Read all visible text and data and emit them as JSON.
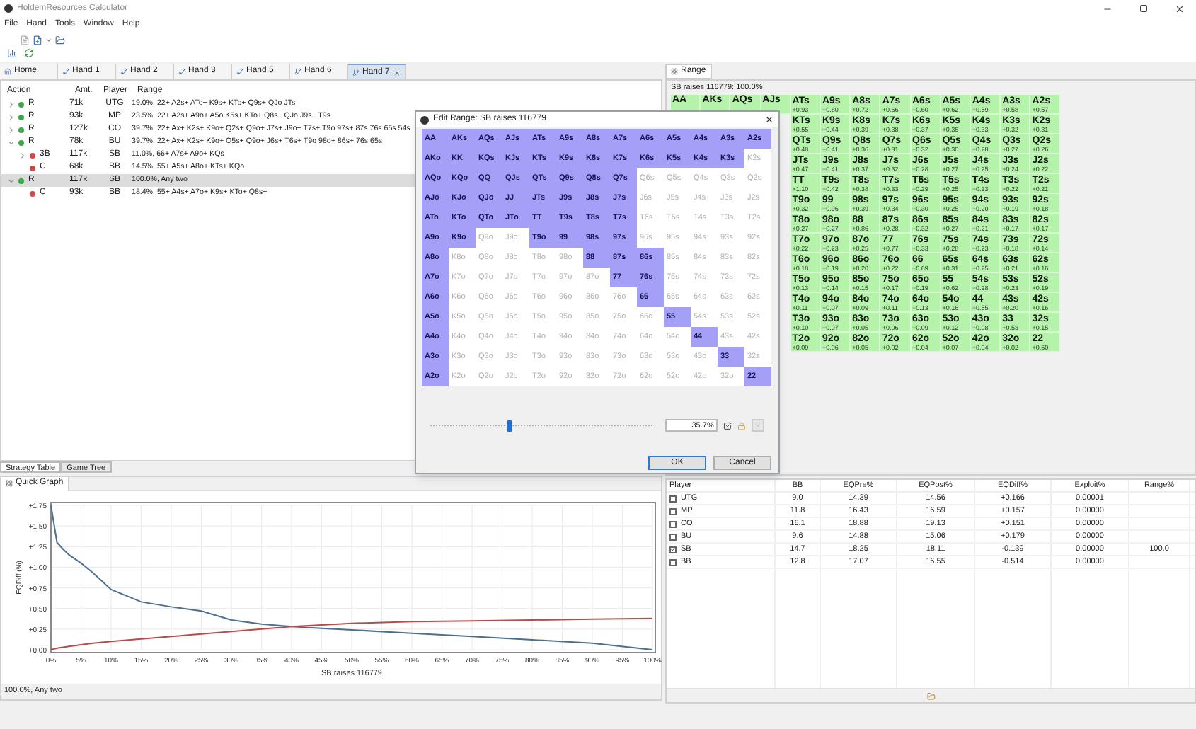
{
  "window": {
    "title": "HoldemResources Calculator"
  },
  "menu": [
    "File",
    "Hand",
    "Tools",
    "Window",
    "Help"
  ],
  "hand_tabs": [
    {
      "label": "Home",
      "selected": false
    },
    {
      "label": "Hand 1",
      "selected": false
    },
    {
      "label": "Hand 2",
      "selected": false
    },
    {
      "label": "Hand 3",
      "selected": false
    },
    {
      "label": "Hand 5",
      "selected": false
    },
    {
      "label": "Hand 6",
      "selected": false
    },
    {
      "label": "Hand 7",
      "selected": true
    }
  ],
  "action_tree": {
    "columns": [
      "Action",
      "Amt.",
      "Player",
      "Range"
    ],
    "items": [
      {
        "kind": "collapsed",
        "action": "R",
        "amt": "71k",
        "player": "UTG",
        "range": "19.0%, 22+ A2s+ ATo+ K9s+ KTo+ Q9s+ QJo JTs",
        "color": "#3ea84a",
        "selected": false
      },
      {
        "kind": "collapsed",
        "action": "R",
        "amt": "93k",
        "player": "MP",
        "range": "23.5%, 22+ A2s+ A9o+ A5o K5s+ KTo+ Q8s+ QJo J9s+ T9s",
        "color": "#3ea84a",
        "selected": false
      },
      {
        "kind": "collapsed",
        "action": "R",
        "amt": "127k",
        "player": "CO",
        "range": "39.7%, 22+ Ax+ K2s+ K9o+ Q2s+ Q9o+ J7s+ J9o+ T7s+ T9o 97s+ 87s 76s 65s 54s",
        "color": "#3ea84a",
        "selected": false
      },
      {
        "kind": "expanded",
        "action": "R",
        "amt": "78k",
        "player": "BU",
        "range": "39.7%, 22+ Ax+ K2s+ K9o+ Q5s+ Q9o+ J6s+ T6s+ T9o 98o+ 86s+ 76s 65s",
        "color": "#3ea84a",
        "selected": false,
        "children": [
          {
            "kind": "collapsed",
            "action": "3B",
            "amt": "117k",
            "player": "SB",
            "range": "11.0%, 66+ A7s+ A9o+ KQs",
            "color": "#d04848",
            "selected": false
          },
          {
            "kind": "leaf",
            "action": "C",
            "amt": "68k",
            "player": "BB",
            "range": "14.5%, 55+ A5s+ A8o+ KTs+ KQo",
            "color": "#d04848",
            "selected": false
          }
        ]
      },
      {
        "kind": "expanded",
        "action": "R",
        "amt": "117k",
        "player": "SB",
        "range": "100.0%, Any two",
        "color": "#3ea84a",
        "selected": true,
        "children": [
          {
            "kind": "leaf",
            "action": "C",
            "amt": "93k",
            "player": "BB",
            "range": "18.4%, 55+ A4s+ A7o+ K9s+ KTo+ Q8s+",
            "color": "#d04848",
            "selected": false
          }
        ]
      }
    ]
  },
  "bottom_tabs": [
    {
      "label": "Strategy Table",
      "selected": true
    },
    {
      "label": "Game Tree",
      "selected": false
    }
  ],
  "quick_graph": {
    "title": "Quick Graph",
    "status": "100.0%, Any two",
    "chart_data": {
      "type": "line",
      "xlabel": "SB raises 116779",
      "ylabel": "EQDiff (%)",
      "x": [
        0,
        1,
        2,
        3,
        5,
        7,
        10,
        15,
        20,
        25,
        30,
        35,
        40,
        45,
        50,
        60,
        70,
        80,
        90,
        100
      ],
      "series": [
        {
          "color": "#4a6f8f",
          "values": [
            1.75,
            1.3,
            1.22,
            1.15,
            1.05,
            0.93,
            0.73,
            0.58,
            0.52,
            0.47,
            0.36,
            0.31,
            0.28,
            0.26,
            0.24,
            0.2,
            0.16,
            0.12,
            0.08,
            0.0
          ]
        },
        {
          "color": "#b84a4a",
          "values": [
            0.0,
            0.02,
            0.03,
            0.04,
            0.06,
            0.08,
            0.1,
            0.13,
            0.16,
            0.19,
            0.22,
            0.25,
            0.28,
            0.3,
            0.32,
            0.34,
            0.35,
            0.36,
            0.37,
            0.38
          ]
        }
      ],
      "xlim": [
        0,
        100
      ],
      "ylim": [
        0,
        1.75
      ],
      "grid": true,
      "xticks": [
        {
          "value": 0,
          "label": "0%"
        },
        {
          "value": 5,
          "label": "5%"
        },
        {
          "value": 10,
          "label": "10%"
        },
        {
          "value": 15,
          "label": "15%"
        },
        {
          "value": 20,
          "label": "20%"
        },
        {
          "value": 25,
          "label": "25%"
        },
        {
          "value": 30,
          "label": "30%"
        },
        {
          "value": 35,
          "label": "35%"
        },
        {
          "value": 40,
          "label": "40%"
        },
        {
          "value": 45,
          "label": "45%"
        },
        {
          "value": 50,
          "label": "50%"
        },
        {
          "value": 55,
          "label": "55%"
        },
        {
          "value": 60,
          "label": "60%"
        },
        {
          "value": 65,
          "label": "65%"
        },
        {
          "value": 70,
          "label": "70%"
        },
        {
          "value": 75,
          "label": "75%"
        },
        {
          "value": 80,
          "label": "80%"
        },
        {
          "value": 85,
          "label": "85%"
        },
        {
          "value": 90,
          "label": "90%"
        },
        {
          "value": 95,
          "label": "95%"
        },
        {
          "value": 100,
          "label": "100%"
        }
      ],
      "yticks": [
        {
          "value": 0,
          "label": "+0.00"
        },
        {
          "value": 0.25,
          "label": "+0.25"
        },
        {
          "value": 0.5,
          "label": "+0.50"
        },
        {
          "value": 0.75,
          "label": "+0.75"
        },
        {
          "value": 1,
          "label": "+1.00"
        },
        {
          "value": 1.25,
          "label": "+1.25"
        },
        {
          "value": 1.5,
          "label": "+1.50"
        },
        {
          "value": 1.75,
          "label": "+1.75"
        }
      ]
    }
  },
  "range_panel": {
    "tab": "Range",
    "title": "SB raises 116779: 100.0%",
    "rows": [
      {
        "cells": [
          {
            "hand": "AA"
          },
          {
            "hand": "AKs"
          },
          {
            "hand": "AQs"
          },
          {
            "hand": "AJs"
          },
          {
            "hand": "ATs",
            "ev": "+0.93"
          },
          {
            "hand": "A9s",
            "ev": "+0.80"
          },
          {
            "hand": "A8s",
            "ev": "+0.72"
          },
          {
            "hand": "A7s",
            "ev": "+0.66"
          },
          {
            "hand": "A6s",
            "ev": "+0.60"
          },
          {
            "hand": "A5s",
            "ev": "+0.62"
          },
          {
            "hand": "A4s",
            "ev": "+0.59"
          },
          {
            "hand": "A3s",
            "ev": "+0.58"
          },
          {
            "hand": "A2s",
            "ev": "+0.57"
          }
        ]
      },
      {
        "cells": [
          {},
          {},
          {},
          {},
          {
            "hand": "KTs",
            "ev": "+0.55"
          },
          {
            "hand": "K9s",
            "ev": "+0.44"
          },
          {
            "hand": "K8s",
            "ev": "+0.39"
          },
          {
            "hand": "K7s",
            "ev": "+0.38"
          },
          {
            "hand": "K6s",
            "ev": "+0.37"
          },
          {
            "hand": "K5s",
            "ev": "+0.35"
          },
          {
            "hand": "K4s",
            "ev": "+0.33"
          },
          {
            "hand": "K3s",
            "ev": "+0.32"
          },
          {
            "hand": "K2s",
            "ev": "+0.31"
          }
        ]
      },
      {
        "cells": [
          {},
          {},
          {},
          {},
          {
            "hand": "QTs",
            "ev": "+0.48"
          },
          {
            "hand": "Q9s",
            "ev": "+0.41"
          },
          {
            "hand": "Q8s",
            "ev": "+0.36"
          },
          {
            "hand": "Q7s",
            "ev": "+0.31"
          },
          {
            "hand": "Q6s",
            "ev": "+0.32"
          },
          {
            "hand": "Q5s",
            "ev": "+0.30"
          },
          {
            "hand": "Q4s",
            "ev": "+0.28"
          },
          {
            "hand": "Q3s",
            "ev": "+0.27"
          },
          {
            "hand": "Q2s",
            "ev": "+0.26"
          }
        ]
      },
      {
        "cells": [
          {},
          {},
          {},
          {},
          {
            "hand": "JTs",
            "ev": "+0.47"
          },
          {
            "hand": "J9s",
            "ev": "+0.41"
          },
          {
            "hand": "J8s",
            "ev": "+0.37"
          },
          {
            "hand": "J7s",
            "ev": "+0.32"
          },
          {
            "hand": "J6s",
            "ev": "+0.28"
          },
          {
            "hand": "J5s",
            "ev": "+0.27"
          },
          {
            "hand": "J4s",
            "ev": "+0.25"
          },
          {
            "hand": "J3s",
            "ev": "+0.24"
          },
          {
            "hand": "J2s",
            "ev": "+0.22"
          }
        ]
      },
      {
        "cells": [
          {},
          {},
          {},
          {},
          {
            "hand": "TT",
            "ev": "+1.10"
          },
          {
            "hand": "T9s",
            "ev": "+0.42"
          },
          {
            "hand": "T8s",
            "ev": "+0.38"
          },
          {
            "hand": "T7s",
            "ev": "+0.33"
          },
          {
            "hand": "T6s",
            "ev": "+0.29"
          },
          {
            "hand": "T5s",
            "ev": "+0.25"
          },
          {
            "hand": "T4s",
            "ev": "+0.23"
          },
          {
            "hand": "T3s",
            "ev": "+0.22"
          },
          {
            "hand": "T2s",
            "ev": "+0.21"
          }
        ]
      },
      {
        "cells": [
          {},
          {},
          {},
          {},
          {
            "hand": "T9o",
            "ev": "+0.32"
          },
          {
            "hand": "99",
            "ev": "+0.96"
          },
          {
            "hand": "98s",
            "ev": "+0.39"
          },
          {
            "hand": "97s",
            "ev": "+0.34"
          },
          {
            "hand": "96s",
            "ev": "+0.30"
          },
          {
            "hand": "95s",
            "ev": "+0.25"
          },
          {
            "hand": "94s",
            "ev": "+0.20"
          },
          {
            "hand": "93s",
            "ev": "+0.19"
          },
          {
            "hand": "92s",
            "ev": "+0.18"
          }
        ]
      },
      {
        "cells": [
          {},
          {},
          {},
          {},
          {
            "hand": "T8o",
            "ev": "+0.27"
          },
          {
            "hand": "98o",
            "ev": "+0.27"
          },
          {
            "hand": "88",
            "ev": "+0.86"
          },
          {
            "hand": "87s",
            "ev": "+0.28"
          },
          {
            "hand": "86s",
            "ev": "+0.32"
          },
          {
            "hand": "85s",
            "ev": "+0.27"
          },
          {
            "hand": "84s",
            "ev": "+0.21"
          },
          {
            "hand": "83s",
            "ev": "+0.17"
          },
          {
            "hand": "82s",
            "ev": "+0.17"
          }
        ]
      },
      {
        "cells": [
          {},
          {},
          {},
          {},
          {
            "hand": "T7o",
            "ev": "+0.22"
          },
          {
            "hand": "97o",
            "ev": "+0.23"
          },
          {
            "hand": "87o",
            "ev": "+0.25"
          },
          {
            "hand": "77",
            "ev": "+0.77"
          },
          {
            "hand": "76s",
            "ev": "+0.33"
          },
          {
            "hand": "75s",
            "ev": "+0.28"
          },
          {
            "hand": "74s",
            "ev": "+0.23"
          },
          {
            "hand": "73s",
            "ev": "+0.18"
          },
          {
            "hand": "72s",
            "ev": "+0.14"
          }
        ]
      },
      {
        "cells": [
          {},
          {},
          {},
          {},
          {
            "hand": "T6o",
            "ev": "+0.18"
          },
          {
            "hand": "96o",
            "ev": "+0.19"
          },
          {
            "hand": "86o",
            "ev": "+0.20"
          },
          {
            "hand": "76o",
            "ev": "+0.22"
          },
          {
            "hand": "66",
            "ev": "+0.69"
          },
          {
            "hand": "65s",
            "ev": "+0.31"
          },
          {
            "hand": "64s",
            "ev": "+0.25"
          },
          {
            "hand": "63s",
            "ev": "+0.21"
          },
          {
            "hand": "62s",
            "ev": "+0.16"
          }
        ]
      },
      {
        "cells": [
          {},
          {},
          {},
          {},
          {
            "hand": "T5o",
            "ev": "+0.13"
          },
          {
            "hand": "95o",
            "ev": "+0.14"
          },
          {
            "hand": "85o",
            "ev": "+0.15"
          },
          {
            "hand": "75o",
            "ev": "+0.17"
          },
          {
            "hand": "65o",
            "ev": "+0.19"
          },
          {
            "hand": "55",
            "ev": "+0.62"
          },
          {
            "hand": "54s",
            "ev": "+0.28"
          },
          {
            "hand": "53s",
            "ev": "+0.23"
          },
          {
            "hand": "52s",
            "ev": "+0.19"
          }
        ]
      },
      {
        "cells": [
          {},
          {},
          {},
          {},
          {
            "hand": "T4o",
            "ev": "+0.11"
          },
          {
            "hand": "94o",
            "ev": "+0.07"
          },
          {
            "hand": "84o",
            "ev": "+0.09"
          },
          {
            "hand": "74o",
            "ev": "+0.11"
          },
          {
            "hand": "64o",
            "ev": "+0.13"
          },
          {
            "hand": "54o",
            "ev": "+0.16"
          },
          {
            "hand": "44",
            "ev": "+0.55"
          },
          {
            "hand": "43s",
            "ev": "+0.20"
          },
          {
            "hand": "42s",
            "ev": "+0.16"
          }
        ]
      },
      {
        "cells": [
          {},
          {},
          {},
          {},
          {
            "hand": "T3o",
            "ev": "+0.10"
          },
          {
            "hand": "93o",
            "ev": "+0.07"
          },
          {
            "hand": "83o",
            "ev": "+0.05"
          },
          {
            "hand": "73o",
            "ev": "+0.06"
          },
          {
            "hand": "63o",
            "ev": "+0.09"
          },
          {
            "hand": "53o",
            "ev": "+0.12"
          },
          {
            "hand": "43o",
            "ev": "+0.08"
          },
          {
            "hand": "33",
            "ev": "+0.53"
          },
          {
            "hand": "32s",
            "ev": "+0.15"
          }
        ]
      },
      {
        "cells": [
          {},
          {},
          {},
          {},
          {
            "hand": "T2o",
            "ev": "+0.09"
          },
          {
            "hand": "92o",
            "ev": "+0.06"
          },
          {
            "hand": "82o",
            "ev": "+0.05"
          },
          {
            "hand": "72o",
            "ev": "+0.02"
          },
          {
            "hand": "62o",
            "ev": "+0.04"
          },
          {
            "hand": "52o",
            "ev": "+0.07"
          },
          {
            "hand": "42o",
            "ev": "+0.04"
          },
          {
            "hand": "32o",
            "ev": "+0.02"
          },
          {
            "hand": "22",
            "ev": "+0.50"
          }
        ]
      }
    ]
  },
  "stats_table": {
    "columns": [
      "Player",
      "BB",
      "EQPre%",
      "EQPost%",
      "EQDiff%",
      "Exploit%",
      "Range%"
    ],
    "rows": [
      {
        "player": "UTG",
        "checked": false,
        "bb": "9.0",
        "eq_pre": "14.39",
        "eq_post": "14.56",
        "eq_diff": "+0.166",
        "exploit": "0.00001"
      },
      {
        "player": "MP",
        "checked": false,
        "bb": "11.8",
        "eq_pre": "16.43",
        "eq_post": "16.59",
        "eq_diff": "+0.157",
        "exploit": "0.00000"
      },
      {
        "player": "CO",
        "checked": false,
        "bb": "16.1",
        "eq_pre": "18.88",
        "eq_post": "19.13",
        "eq_diff": "+0.151",
        "exploit": "0.00000"
      },
      {
        "player": "BU",
        "checked": false,
        "bb": "9.6",
        "eq_pre": "14.88",
        "eq_post": "15.06",
        "eq_diff": "+0.179",
        "exploit": "0.00000"
      },
      {
        "player": "SB",
        "checked": true,
        "bb": "14.7",
        "eq_pre": "18.25",
        "eq_post": "18.11",
        "eq_diff": "-0.139",
        "exploit": "0.00000",
        "range": "100.0"
      },
      {
        "player": "BB",
        "checked": false,
        "bb": "12.8",
        "eq_pre": "17.07",
        "eq_post": "16.55",
        "eq_diff": "-0.514",
        "exploit": "0.00000"
      }
    ]
  },
  "dialog": {
    "title": "Edit Range: SB raises 116779",
    "level": 0.357,
    "percent": "35.7%",
    "buttons": [
      "OK",
      "Cancel"
    ],
    "rows": [
      {
        "cells": [
          {
            "label": "AA",
            "selected": true
          },
          {
            "label": "AKs",
            "selected": true
          },
          {
            "label": "AQs",
            "selected": true
          },
          {
            "label": "AJs",
            "selected": true
          },
          {
            "label": "ATs",
            "selected": true
          },
          {
            "label": "A9s",
            "selected": true
          },
          {
            "label": "A8s",
            "selected": true
          },
          {
            "label": "A7s",
            "selected": true
          },
          {
            "label": "A6s",
            "selected": true
          },
          {
            "label": "A5s",
            "selected": true
          },
          {
            "label": "A4s",
            "selected": true
          },
          {
            "label": "A3s",
            "selected": true
          },
          {
            "label": "A2s",
            "selected": true
          }
        ]
      },
      {
        "cells": [
          {
            "label": "AKo",
            "selected": true
          },
          {
            "label": "KK",
            "selected": true
          },
          {
            "label": "KQs",
            "selected": true
          },
          {
            "label": "KJs",
            "selected": true
          },
          {
            "label": "KTs",
            "selected": true
          },
          {
            "label": "K9s",
            "selected": true
          },
          {
            "label": "K8s",
            "selected": true
          },
          {
            "label": "K7s",
            "selected": true
          },
          {
            "label": "K6s",
            "selected": true
          },
          {
            "label": "K5s",
            "selected": true
          },
          {
            "label": "K4s",
            "selected": true
          },
          {
            "label": "K3s",
            "selected": true
          },
          {
            "label": "K2s",
            "selected": false
          }
        ]
      },
      {
        "cells": [
          {
            "label": "AQo",
            "selected": true
          },
          {
            "label": "KQo",
            "selected": true
          },
          {
            "label": "QQ",
            "selected": true
          },
          {
            "label": "QJs",
            "selected": true
          },
          {
            "label": "QTs",
            "selected": true
          },
          {
            "label": "Q9s",
            "selected": true
          },
          {
            "label": "Q8s",
            "selected": true
          },
          {
            "label": "Q7s",
            "selected": true
          },
          {
            "label": "Q6s",
            "selected": false
          },
          {
            "label": "Q5s",
            "selected": false
          },
          {
            "label": "Q4s",
            "selected": false
          },
          {
            "label": "Q3s",
            "selected": false
          },
          {
            "label": "Q2s",
            "selected": false
          }
        ]
      },
      {
        "cells": [
          {
            "label": "AJo",
            "selected": true
          },
          {
            "label": "KJo",
            "selected": true
          },
          {
            "label": "QJo",
            "selected": true
          },
          {
            "label": "JJ",
            "selected": true
          },
          {
            "label": "JTs",
            "selected": true
          },
          {
            "label": "J9s",
            "selected": true
          },
          {
            "label": "J8s",
            "selected": true
          },
          {
            "label": "J7s",
            "selected": true
          },
          {
            "label": "J6s",
            "selected": false
          },
          {
            "label": "J5s",
            "selected": false
          },
          {
            "label": "J4s",
            "selected": false
          },
          {
            "label": "J3s",
            "selected": false
          },
          {
            "label": "J2s",
            "selected": false
          }
        ]
      },
      {
        "cells": [
          {
            "label": "ATo",
            "selected": true
          },
          {
            "label": "KTo",
            "selected": true
          },
          {
            "label": "QTo",
            "selected": true
          },
          {
            "label": "JTo",
            "selected": true
          },
          {
            "label": "TT",
            "selected": true
          },
          {
            "label": "T9s",
            "selected": true
          },
          {
            "label": "T8s",
            "selected": true
          },
          {
            "label": "T7s",
            "selected": true
          },
          {
            "label": "T6s",
            "selected": false
          },
          {
            "label": "T5s",
            "selected": false
          },
          {
            "label": "T4s",
            "selected": false
          },
          {
            "label": "T3s",
            "selected": false
          },
          {
            "label": "T2s",
            "selected": false
          }
        ]
      },
      {
        "cells": [
          {
            "label": "A9o",
            "selected": true
          },
          {
            "label": "K9o",
            "selected": true
          },
          {
            "label": "Q9o",
            "selected": false
          },
          {
            "label": "J9o",
            "selected": false
          },
          {
            "label": "T9o",
            "selected": true
          },
          {
            "label": "99",
            "selected": true
          },
          {
            "label": "98s",
            "selected": true
          },
          {
            "label": "97s",
            "selected": true
          },
          {
            "label": "96s",
            "selected": false
          },
          {
            "label": "95s",
            "selected": false
          },
          {
            "label": "94s",
            "selected": false
          },
          {
            "label": "93s",
            "selected": false
          },
          {
            "label": "92s",
            "selected": false
          }
        ]
      },
      {
        "cells": [
          {
            "label": "A8o",
            "selected": true
          },
          {
            "label": "K8o",
            "selected": false
          },
          {
            "label": "Q8o",
            "selected": false
          },
          {
            "label": "J8o",
            "selected": false
          },
          {
            "label": "T8o",
            "selected": false
          },
          {
            "label": "98o",
            "selected": false
          },
          {
            "label": "88",
            "selected": true
          },
          {
            "label": "87s",
            "selected": true
          },
          {
            "label": "86s",
            "selected": true
          },
          {
            "label": "85s",
            "selected": false
          },
          {
            "label": "84s",
            "selected": false
          },
          {
            "label": "83s",
            "selected": false
          },
          {
            "label": "82s",
            "selected": false
          }
        ]
      },
      {
        "cells": [
          {
            "label": "A7o",
            "selected": true
          },
          {
            "label": "K7o",
            "selected": false
          },
          {
            "label": "Q7o",
            "selected": false
          },
          {
            "label": "J7o",
            "selected": false
          },
          {
            "label": "T7o",
            "selected": false
          },
          {
            "label": "97o",
            "selected": false
          },
          {
            "label": "87o",
            "selected": false
          },
          {
            "label": "77",
            "selected": true
          },
          {
            "label": "76s",
            "selected": true
          },
          {
            "label": "75s",
            "selected": false
          },
          {
            "label": "74s",
            "selected": false
          },
          {
            "label": "73s",
            "selected": false
          },
          {
            "label": "72s",
            "selected": false
          }
        ]
      },
      {
        "cells": [
          {
            "label": "A6o",
            "selected": true
          },
          {
            "label": "K6o",
            "selected": false
          },
          {
            "label": "Q6o",
            "selected": false
          },
          {
            "label": "J6o",
            "selected": false
          },
          {
            "label": "T6o",
            "selected": false
          },
          {
            "label": "96o",
            "selected": false
          },
          {
            "label": "86o",
            "selected": false
          },
          {
            "label": "76o",
            "selected": false
          },
          {
            "label": "66",
            "selected": true
          },
          {
            "label": "65s",
            "selected": false
          },
          {
            "label": "64s",
            "selected": false
          },
          {
            "label": "63s",
            "selected": false
          },
          {
            "label": "62s",
            "selected": false
          }
        ]
      },
      {
        "cells": [
          {
            "label": "A5o",
            "selected": true
          },
          {
            "label": "K5o",
            "selected": false
          },
          {
            "label": "Q5o",
            "selected": false
          },
          {
            "label": "J5o",
            "selected": false
          },
          {
            "label": "T5o",
            "selected": false
          },
          {
            "label": "95o",
            "selected": false
          },
          {
            "label": "85o",
            "selected": false
          },
          {
            "label": "75o",
            "selected": false
          },
          {
            "label": "65o",
            "selected": false
          },
          {
            "label": "55",
            "selected": true
          },
          {
            "label": "54s",
            "selected": false
          },
          {
            "label": "53s",
            "selected": false
          },
          {
            "label": "52s",
            "selected": false
          }
        ]
      },
      {
        "cells": [
          {
            "label": "A4o",
            "selected": true
          },
          {
            "label": "K4o",
            "selected": false
          },
          {
            "label": "Q4o",
            "selected": false
          },
          {
            "label": "J4o",
            "selected": false
          },
          {
            "label": "T4o",
            "selected": false
          },
          {
            "label": "94o",
            "selected": false
          },
          {
            "label": "84o",
            "selected": false
          },
          {
            "label": "74o",
            "selected": false
          },
          {
            "label": "64o",
            "selected": false
          },
          {
            "label": "54o",
            "selected": false
          },
          {
            "label": "44",
            "selected": true
          },
          {
            "label": "43s",
            "selected": false
          },
          {
            "label": "42s",
            "selected": false
          }
        ]
      },
      {
        "cells": [
          {
            "label": "A3o",
            "selected": true
          },
          {
            "label": "K3o",
            "selected": false
          },
          {
            "label": "Q3o",
            "selected": false
          },
          {
            "label": "J3o",
            "selected": false
          },
          {
            "label": "T3o",
            "selected": false
          },
          {
            "label": "93o",
            "selected": false
          },
          {
            "label": "83o",
            "selected": false
          },
          {
            "label": "73o",
            "selected": false
          },
          {
            "label": "63o",
            "selected": false
          },
          {
            "label": "53o",
            "selected": false
          },
          {
            "label": "43o",
            "selected": false
          },
          {
            "label": "33",
            "selected": true
          },
          {
            "label": "32s",
            "selected": false
          }
        ]
      },
      {
        "cells": [
          {
            "label": "A2o",
            "selected": true
          },
          {
            "label": "K2o",
            "selected": false
          },
          {
            "label": "Q2o",
            "selected": false
          },
          {
            "label": "J2o",
            "selected": false
          },
          {
            "label": "T2o",
            "selected": false
          },
          {
            "label": "92o",
            "selected": false
          },
          {
            "label": "82o",
            "selected": false
          },
          {
            "label": "72o",
            "selected": false
          },
          {
            "label": "62o",
            "selected": false
          },
          {
            "label": "52o",
            "selected": false
          },
          {
            "label": "42o",
            "selected": false
          },
          {
            "label": "32o",
            "selected": false
          },
          {
            "label": "22",
            "selected": true
          }
        ]
      }
    ]
  }
}
